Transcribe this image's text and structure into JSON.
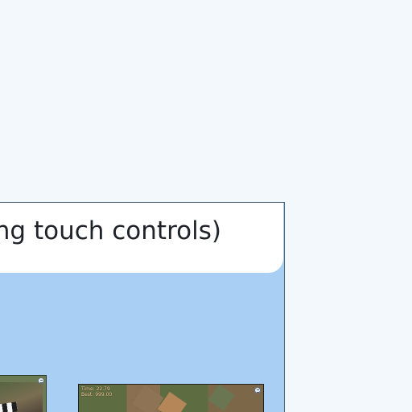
{
  "page": {
    "background_color": "#f3f8fd",
    "panel_color": "#a9d0f4"
  },
  "title": {
    "text": "ting touch controls)"
  },
  "previews": [
    {
      "hud_time": "",
      "hud_best": "",
      "icon": "menu-icon"
    },
    {
      "hud_time": "Time: 22.79",
      "hud_best": "Best: 999.00",
      "icon": "menu-icon"
    }
  ]
}
